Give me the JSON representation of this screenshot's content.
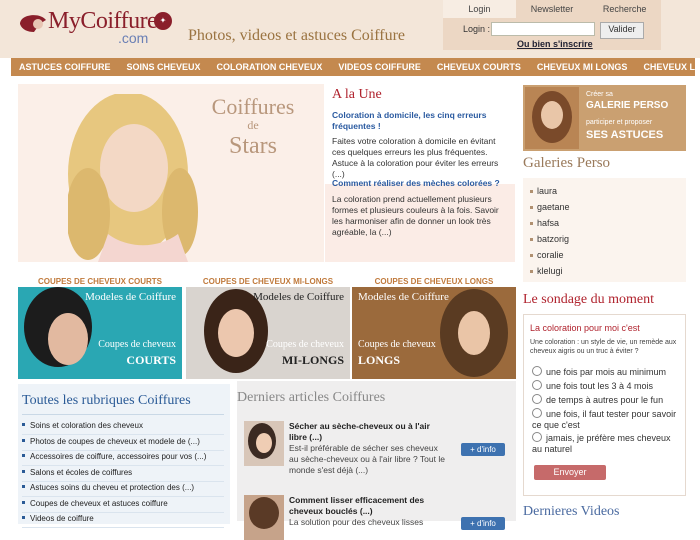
{
  "header": {
    "brand": "MyCoiffure",
    "brand_suffix": ".com",
    "tagline": "Photos, videos et astuces Coiffure",
    "tabs": [
      "Login",
      "Newsletter",
      "Recherche"
    ],
    "login_label": "Login :",
    "login_value": "",
    "login_button": "Valider",
    "forgot": "Ou bien s'inscrire"
  },
  "nav": [
    "ASTUCES COIFFURE",
    "SOINS CHEVEUX",
    "COLORATION CHEVEUX",
    "VIDEOS COIFFURE",
    "CHEVEUX COURTS",
    "CHEVEUX MI LONGS",
    "CHEVEUX LONGS"
  ],
  "hero": {
    "line1": "Coiffures",
    "line2": "de",
    "line3": "Stars"
  },
  "a_la_une": {
    "title": "A la Une",
    "articles": [
      {
        "headline": "Coloration à domicile, les cinq erreurs fréquentes !",
        "text": "Faites votre coloration à domicile en évitant ces quelques erreurs les plus fréquentes. Astuce à la coloration pour éviter les erreurs (...)"
      },
      {
        "headline": "Comment réaliser des mèches colorées ?",
        "text": "La coloration prend actuellement plusieurs formes et plusieurs couleurs à la fois. Savoir les harmoniser afin de donner un look très agréable, la (...)"
      }
    ]
  },
  "galerie_banner": {
    "l1": "Créer sa",
    "l2": "GALERIE PERSO",
    "l3": "participer et proposer",
    "l4": "SES ASTUCES"
  },
  "galeries": {
    "title": "Galeries Perso",
    "items": [
      "laura",
      "gaetane",
      "hafsa",
      "batzorig",
      "coralie",
      "klelugi"
    ]
  },
  "sondage": {
    "title": "Le sondage du moment",
    "question": "La coloration pour moi c'est",
    "desc": "Une coloration : un style de vie, un remède aux cheveux aigris ou un truc à éviter ?",
    "options": [
      "une fois par mois au minimum",
      "une fois tout les 3 à 4 mois",
      "de temps à autres pour le fun",
      "une fois, il faut tester pour savoir ce que c'est",
      "jamais, je préfère mes cheveux au naturel"
    ],
    "button": "Envoyer"
  },
  "videos_title": "Dernieres Videos",
  "coupes": [
    {
      "label": "COUPES DE CHEVEUX COURTS",
      "m1": "Modeles de Coiffure",
      "m2": "Coupes de cheveux",
      "m3": "COURTS"
    },
    {
      "label": "COUPES DE CHEVEUX MI-LONGS",
      "m1": "Modeles de Coiffure",
      "m2": "Coupes de cheveux",
      "m3": "MI-LONGS"
    },
    {
      "label": "COUPES DE CHEVEUX LONGS",
      "m1": "Modeles de Coiffure",
      "m2": "Coupes de cheveux",
      "m3": "LONGS"
    }
  ],
  "rubriques": {
    "title": "Toutes les rubriques Coiffures",
    "items": [
      "Soins et coloration des cheveux",
      "Photos de coupes de cheveux et modele de (...)",
      "Accessoires de coiffure, accessoires pour vos (...)",
      "Salons et écoles de coiffures",
      "Astuces soins du cheveu et protection des (...)",
      "Coupes de cheveux et astuces coiffure",
      "Videos de coiffure"
    ]
  },
  "articles": {
    "title": "Derniers articles Coiffures",
    "items": [
      {
        "title": "Sécher au sèche-cheveux ou à l'air libre (...)",
        "text": "Est-il préférable de sécher ses cheveux au sèche-cheveux ou à l'air libre ? Tout le monde s'est déjà (...)",
        "more": "+ d'info"
      },
      {
        "title": "Comment lisser efficacement des cheveux bouclés (...)",
        "text": "La solution pour des cheveux lisses",
        "more": "+ d'info"
      }
    ]
  },
  "colors": {
    "nav": "#c4894f",
    "header": "#f3e6d9",
    "accent_red": "#b0232e",
    "blue": "#2a5a96"
  }
}
